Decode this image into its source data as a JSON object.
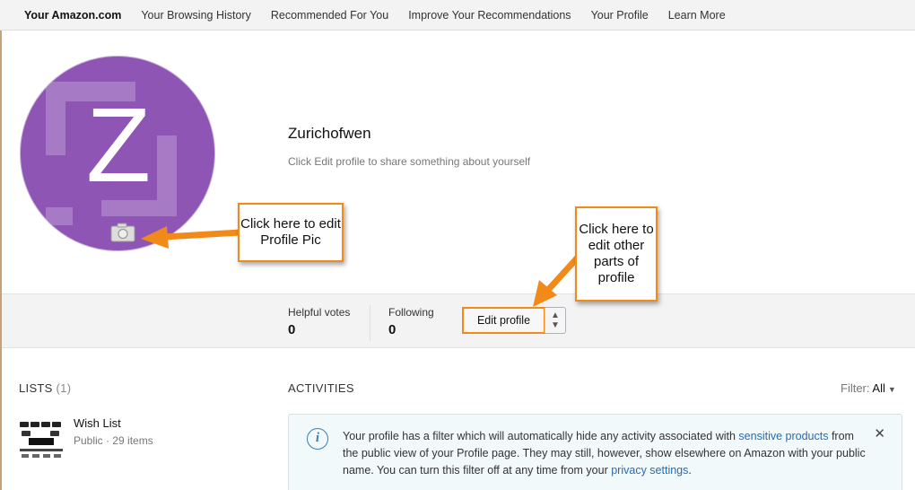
{
  "nav": {
    "items": [
      {
        "label": "Your Amazon.com"
      },
      {
        "label": "Your Browsing History"
      },
      {
        "label": "Recommended For You"
      },
      {
        "label": "Improve Your Recommendations"
      },
      {
        "label": "Your Profile"
      },
      {
        "label": "Learn More"
      }
    ]
  },
  "profile": {
    "avatar_letter": "Z",
    "avatar_color": "#8f55b5",
    "camera_icon": "camera-icon",
    "name": "Zurichofwen",
    "bio_hint": "Click Edit profile to share something about yourself"
  },
  "stats": {
    "helpful_votes_label": "Helpful votes",
    "helpful_votes_value": "0",
    "following_label": "Following",
    "following_value": "0",
    "edit_button_label": "Edit profile"
  },
  "callouts": {
    "profile_pic": "Click here to edit Profile Pic",
    "edit_other": "Click here to edit other parts of profile",
    "color": "#f28a1a"
  },
  "lists": {
    "heading": "LISTS",
    "count": "(1)",
    "items": [
      {
        "name": "Wish List",
        "meta": "Public · 29 items"
      }
    ]
  },
  "activities": {
    "heading": "ACTIVITIES",
    "filter_label": "Filter:",
    "filter_value": "All",
    "notice": {
      "text_1": "Your profile has a filter which will automatically hide any activity associated with ",
      "link_1": "sensitive products",
      "text_2": " from the public view of your Profile page. They may still, however, show elsewhere on Amazon with your public name.  You can turn this filter off at any time from your ",
      "link_2": "privacy settings",
      "text_3": ".",
      "info_icon": "i",
      "close_icon": "✕"
    }
  }
}
